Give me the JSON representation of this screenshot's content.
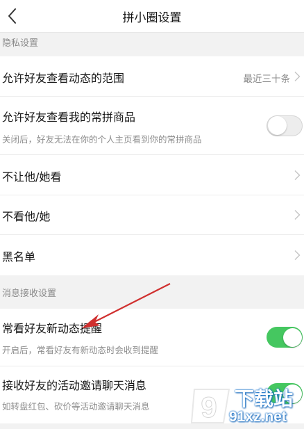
{
  "nav": {
    "title": "拼小圈设置",
    "back_icon": "chevron-left-icon"
  },
  "sections": {
    "privacy": {
      "header": "隐私设置"
    },
    "messages": {
      "header": "消息接收设置"
    }
  },
  "privacy_rows": [
    {
      "label": "允许好友查看动态的范围",
      "value": "最近三十条"
    },
    {
      "label": "允许好友查看我的常拼商品",
      "sub": "关闭后，好友无法在你的个人主页看到你的常拼商品",
      "toggle": "off"
    },
    {
      "label": "不让他/她看"
    },
    {
      "label": "不看他/她"
    },
    {
      "label": "黑名单"
    }
  ],
  "message_rows": [
    {
      "label": "常看好友新动态提醒",
      "sub": "开启后，常看好友有新动态时会收到提醒",
      "toggle": "on"
    },
    {
      "label": "接收好友的活动邀请聊天消息",
      "sub": "如转盘红包、砍价等活动邀请聊天消息",
      "toggle": "on"
    }
  ],
  "colors": {
    "toggle_on": "#45c760",
    "annotation_arrow": "#d0302f"
  },
  "watermark": {
    "text_top": "下载站",
    "text_bottom": "91xz.net",
    "logo_glyph": "9"
  }
}
